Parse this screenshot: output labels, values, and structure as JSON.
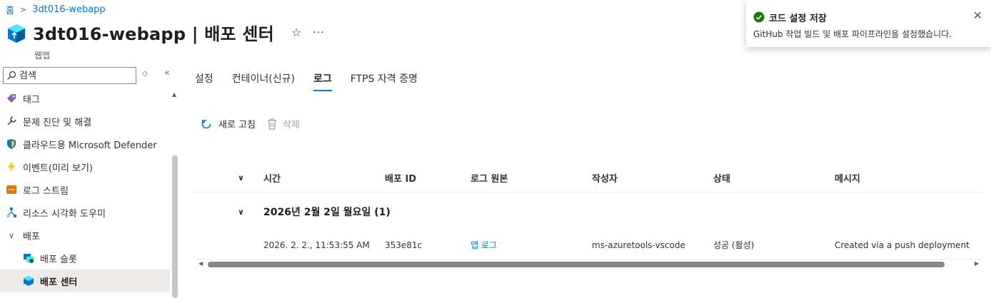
{
  "breadcrumb": {
    "home": "홈",
    "current": "3dt016-webapp"
  },
  "header": {
    "title": "3dt016-webapp | 배포 센터",
    "subtitle": "웹앱",
    "favorite_icon": "star-icon",
    "more_label": "···"
  },
  "search": {
    "placeholder": "검색"
  },
  "sidebar": {
    "items": [
      {
        "label": "태그",
        "icon": "tag-icon",
        "color": "#8764b8"
      },
      {
        "label": "문제 진단 및 해결",
        "icon": "wrench-icon",
        "color": "#323130"
      },
      {
        "label": "클라우드용 Microsoft Defender",
        "icon": "shield-icon",
        "color": "#0078d4"
      },
      {
        "label": "이벤트(미리 보기)",
        "icon": "lightning-icon",
        "color": "#f2c811"
      },
      {
        "label": "로그 스트림",
        "icon": "log-stream-icon",
        "color": "#e8760e"
      },
      {
        "label": "리소스 시각화 도우미",
        "icon": "network-icon",
        "color": "#0078d4"
      },
      {
        "label": "배포",
        "icon": "chevron-down-icon",
        "group": true
      },
      {
        "label": "배포 슬롯",
        "icon": "deployment-slots-icon",
        "sub": true
      },
      {
        "label": "배포 센터",
        "icon": "deployment-center-icon",
        "sub": true,
        "active": true
      }
    ]
  },
  "tabs": [
    {
      "label": "설정",
      "active": false
    },
    {
      "label": "컨테이너(신규)",
      "active": false
    },
    {
      "label": "로그",
      "active": true
    },
    {
      "label": "FTPS 자격 증명",
      "active": false
    }
  ],
  "toolbar": {
    "refresh_label": "새로 고침",
    "delete_label": "삭제"
  },
  "grid": {
    "columns": [
      "시간",
      "배포 ID",
      "로그 원본",
      "작성자",
      "상태",
      "메시지"
    ],
    "group_label": "2026년 2월 2일 월요일 (1)",
    "rows": [
      {
        "time": "2026. 2. 2., 11:53:55 AM",
        "deployment_id": "353e81c",
        "log_source": "앱 로그",
        "author": "ms-azuretools-vscode",
        "status": "성공 (활성)",
        "message": "Created via a push deployment"
      }
    ]
  },
  "toast": {
    "title": "코드 설정 저장",
    "message": "GitHub 작업 빌드 및 배포 파이프라인을 설정했습니다.",
    "status_color": "#107c10"
  },
  "colors": {
    "accent": "#0078d4",
    "success": "#107c10"
  }
}
